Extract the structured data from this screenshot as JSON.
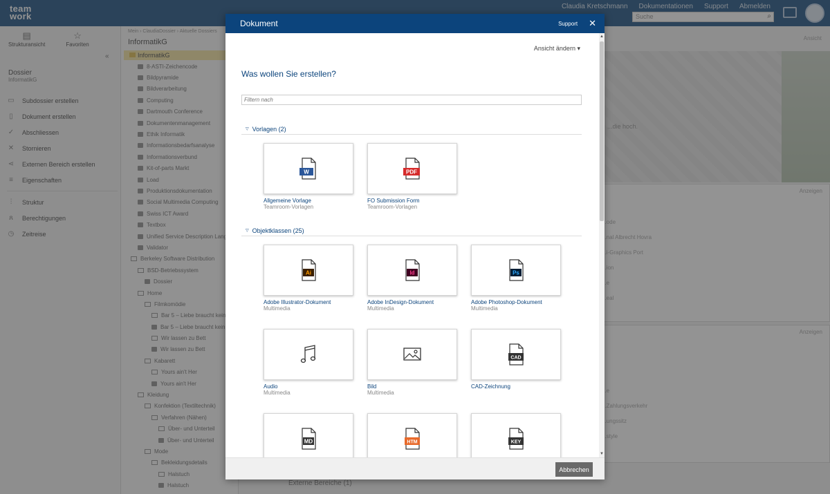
{
  "app": {
    "logo_top": "team",
    "logo_bottom": "work",
    "nav": [
      "Claudia Kretschmann",
      "Dokumentationen",
      "Support",
      "Abmelden"
    ],
    "search_placeholder": "Suche"
  },
  "left_panel": {
    "tools": [
      "Strukturansicht",
      "Favoriten"
    ],
    "heading": "Dossier",
    "sub_heading": "InformatikG",
    "menu": [
      "Subdossier erstellen",
      "Dokument erstellen",
      "Abschliessen",
      "Stornieren",
      "Externen Bereich erstellen",
      "Eigenschaften",
      "Struktur",
      "Berechtigungen",
      "Zeitreise"
    ]
  },
  "tree": {
    "breadcrumb": "Mein  ›  ClaudiaDossier  ›  Aktuelle Dossiers",
    "title": "InformatikG",
    "root": "InformatikG",
    "items": [
      "8-ASTI-Zeichencode",
      "Bildpyramide",
      "Bildverarbeitung",
      "Computing",
      "Dartmouth Conference",
      "Dokumentenmanagement",
      "Ethik Informatik",
      "Informationsbedarfsanalyse",
      "Informationsverbund",
      "Kit-of-parts Markt",
      "Load",
      "Produktionsdokumentation",
      "Social Multimedia Computing",
      "Swiss ICT Award",
      "Textbox",
      "Unified Service Description Lang",
      "Validator",
      "Berkeley Software Distribution",
      "BSD-Betriebssystem",
      "Dossier",
      "Home",
      "Filmkomödie",
      "Bar 5 – Liebe braucht keine",
      "Bar 5 – Liebe braucht kein",
      "Wir lassen zu Bett",
      "Wir lassen zu Bett",
      "Kabarett",
      "Yours ain't Her",
      "Yours ain't Her",
      "Kleidung",
      "Konfektion (Textiltechnik)",
      "Verfahren (Nähen)",
      "Über- und Unterteil",
      "Über- und Unterteil",
      "Mode",
      "Bekleidungsdetails",
      "Halstuch",
      "Halstuch"
    ]
  },
  "right_area": {
    "right_label": "Ansicht",
    "hero_text": "...die hoch.",
    "card1_action": "Anzeigen",
    "card1_items": [
      "...ode",
      "...nal Albrecht Hovra",
      "...i-Graphics Port",
      "...ion",
      "...e",
      "...eal"
    ],
    "card2_action": "Anzeigen",
    "card2_items": [
      "...e",
      "...Zahlungsverkehr",
      "...ungssitz",
      "...style"
    ],
    "external": "Externe Bereiche (1)"
  },
  "modal": {
    "title": "Dokument",
    "support": "Support",
    "view_toggle": "Ansicht ändern",
    "question": "Was wollen Sie erstellen?",
    "filter_placeholder": "Filtern nach",
    "sections": {
      "templates": "Vorlagen (2)",
      "object_classes": "Objektklassen (25)"
    },
    "templates": [
      {
        "name": "Allgemeine Vorlage",
        "sub": "Teamroom-Vorlagen",
        "icon": "word-file-icon",
        "badge": "W",
        "color": "#2b579a"
      },
      {
        "name": "FO Submission Form",
        "sub": "Teamroom-Vorlagen",
        "icon": "pdf-file-icon",
        "badge": "PDF",
        "color": "#d52b2b"
      }
    ],
    "object_classes": [
      {
        "name": "Adobe Illustrator-Dokument",
        "sub": "Multimedia",
        "icon": "illustrator-file-icon",
        "badge": "Ai",
        "color": "#ff9a00",
        "bg": "#3a1f00"
      },
      {
        "name": "Adobe InDesign-Dokument",
        "sub": "Multimedia",
        "icon": "indesign-file-icon",
        "badge": "Id",
        "color": "#ff3d8b",
        "bg": "#3f0020"
      },
      {
        "name": "Adobe Photoshop-Dokument",
        "sub": "Multimedia",
        "icon": "photoshop-file-icon",
        "badge": "Ps",
        "color": "#31a8ff",
        "bg": "#001e36"
      },
      {
        "name": "Audio",
        "sub": "Multimedia",
        "icon": "music-note-icon"
      },
      {
        "name": "Bild",
        "sub": "Multimedia",
        "icon": "image-icon"
      },
      {
        "name": "CAD-Zeichnung",
        "sub": "",
        "icon": "cad-file-icon",
        "badge": "CAD",
        "color": "#ffffff",
        "bg": "#333333"
      },
      {
        "name": "",
        "sub": "",
        "icon": "markdown-file-icon",
        "badge": "MD",
        "color": "#ffffff",
        "bg": "#333333"
      },
      {
        "name": "",
        "sub": "",
        "icon": "html-file-icon",
        "badge": "HTM",
        "color": "#ffffff",
        "bg": "#e86a2b"
      },
      {
        "name": "",
        "sub": "",
        "icon": "keynote-file-icon",
        "badge": "KEY",
        "color": "#ffffff",
        "bg": "#333333"
      }
    ],
    "cancel": "Abbrechen"
  }
}
